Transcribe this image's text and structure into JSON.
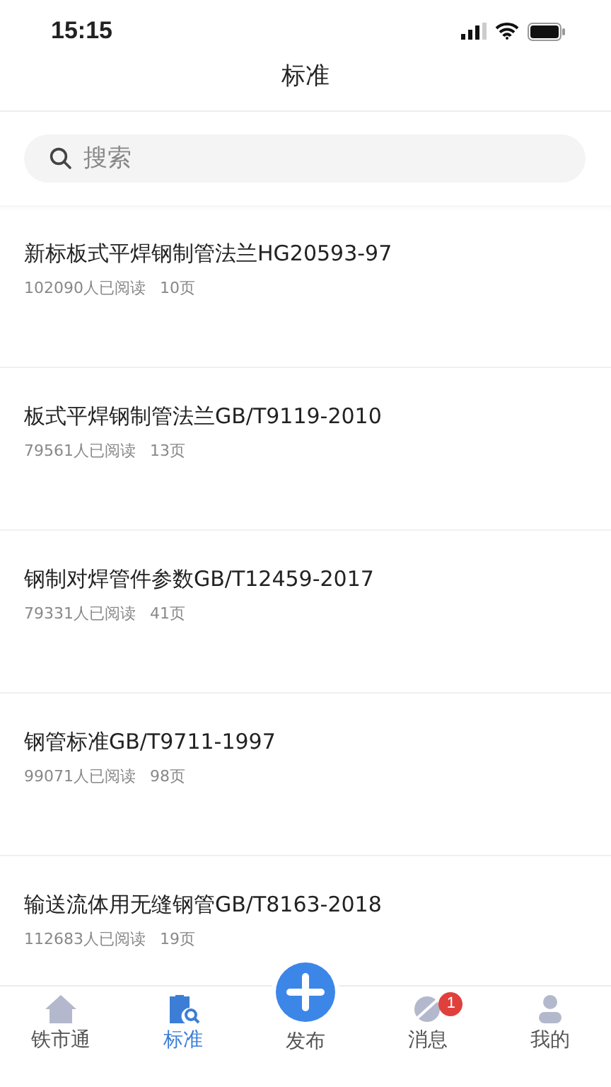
{
  "status_bar": {
    "time": "15:15"
  },
  "header": {
    "title": "标准"
  },
  "search": {
    "placeholder": "搜索"
  },
  "standards": [
    {
      "title": "新标板式平焊钢制管法兰HG20593-97",
      "readers": "102090人已阅读",
      "pages": "10页"
    },
    {
      "title": "板式平焊钢制管法兰GB/T9119-2010",
      "readers": "79561人已阅读",
      "pages": "13页"
    },
    {
      "title": "钢制对焊管件参数GB/T12459-2017",
      "readers": "79331人已阅读",
      "pages": "41页"
    },
    {
      "title": "钢管标准GB/T9711-1997",
      "readers": "99071人已阅读",
      "pages": "98页"
    },
    {
      "title": "输送流体用无缝钢管GB/T8163-2018",
      "readers": "112683人已阅读",
      "pages": "19页"
    }
  ],
  "tab_bar": [
    {
      "kind": "home",
      "label": "铁市通",
      "selected": false
    },
    {
      "kind": "standard",
      "label": "标准",
      "selected": true
    },
    {
      "kind": "publish",
      "label": "发布",
      "selected": false
    },
    {
      "kind": "message",
      "label": "消息",
      "selected": false,
      "badge": "1"
    },
    {
      "kind": "profile",
      "label": "我的",
      "selected": false
    }
  ]
}
